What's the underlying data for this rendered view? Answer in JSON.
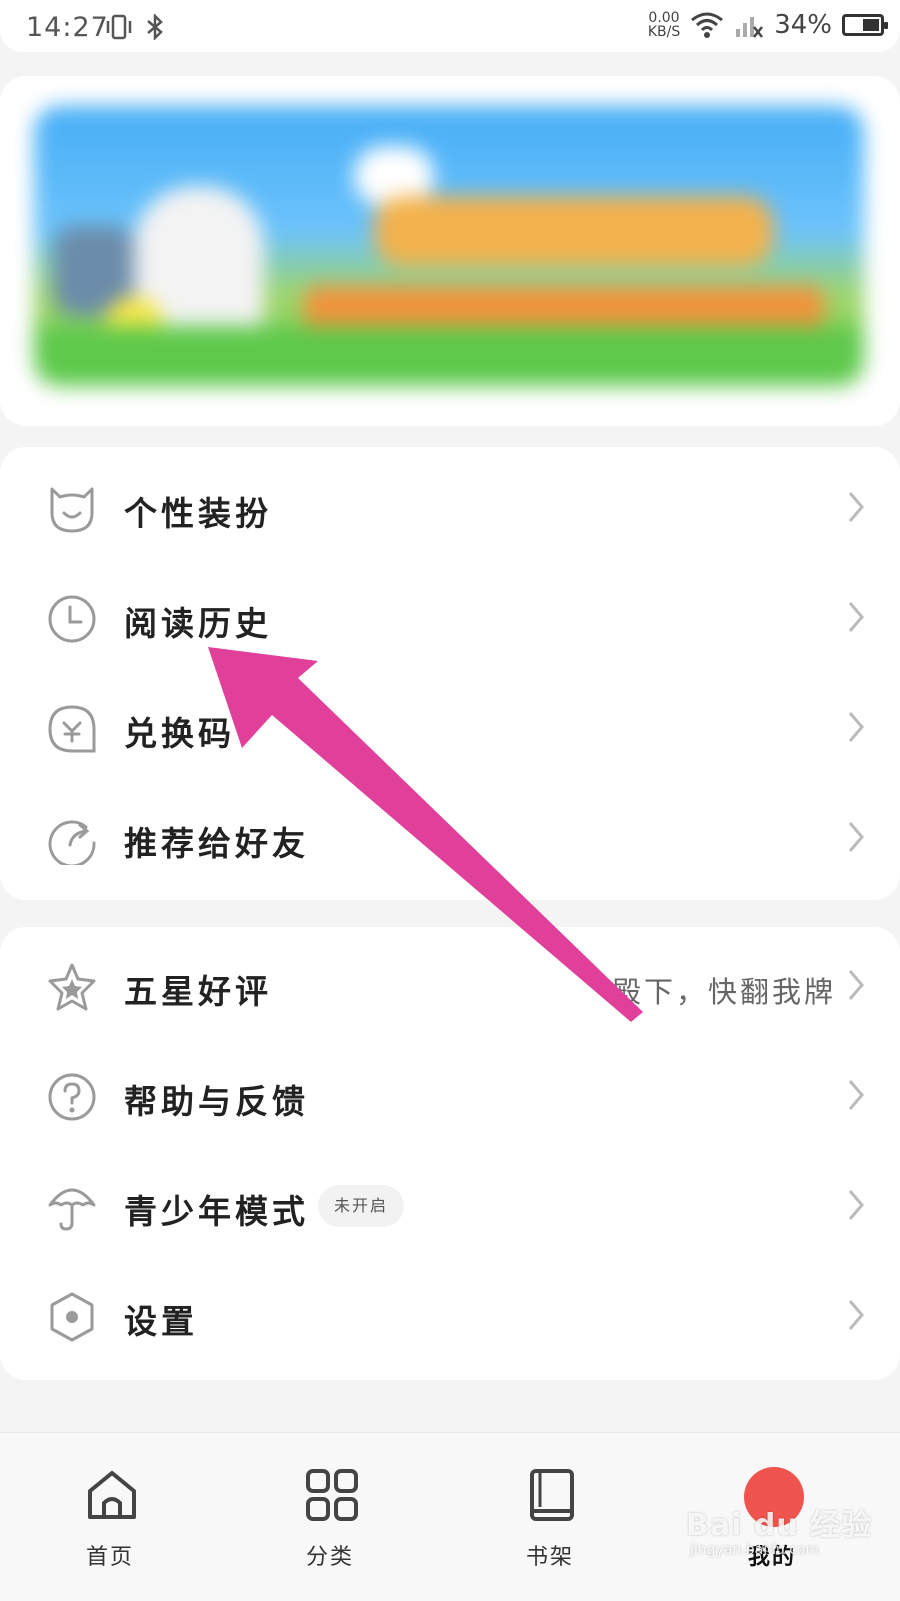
{
  "status_bar": {
    "time": "14:27",
    "net_speed_value": "0.00",
    "net_speed_unit": "KB/S",
    "battery": "34%",
    "icons": [
      "vibrate-icon",
      "bluetooth-icon",
      "wifi-icon",
      "no-signal-icon",
      "battery-icon"
    ]
  },
  "banner": {
    "icon": "promo-banner-image"
  },
  "menu_group_1": [
    {
      "label": "个性装扮",
      "icon": "cat-face-icon"
    },
    {
      "label": "阅读历史",
      "icon": "clock-icon"
    },
    {
      "label": "兑换码",
      "icon": "redeem-code-icon"
    },
    {
      "label": "推荐给好友",
      "icon": "share-icon"
    }
  ],
  "menu_group_2": [
    {
      "label": "五星好评",
      "icon": "star-icon",
      "right_text": "殿下，快翻我牌"
    },
    {
      "label": "帮助与反馈",
      "icon": "help-icon"
    },
    {
      "label": "青少年模式",
      "icon": "umbrella-icon",
      "badge": "未开启"
    },
    {
      "label": "设置",
      "icon": "settings-hexagon-icon"
    }
  ],
  "bottom_nav": [
    {
      "label": "首页",
      "icon": "home-icon"
    },
    {
      "label": "分类",
      "icon": "grid-icon"
    },
    {
      "label": "书架",
      "icon": "bookshelf-icon"
    },
    {
      "label": "我的",
      "icon": "profile-avatar-icon",
      "active": true
    }
  ],
  "watermark": {
    "text": "Bai du 经验",
    "sub": "jingyan.baidu.com"
  },
  "colors": {
    "arrow": "#e0409a",
    "page_bg": "#f4f4f4",
    "card_bg": "#ffffff",
    "icon_gray": "#9a9a9a",
    "avatar": "#f0544e"
  }
}
